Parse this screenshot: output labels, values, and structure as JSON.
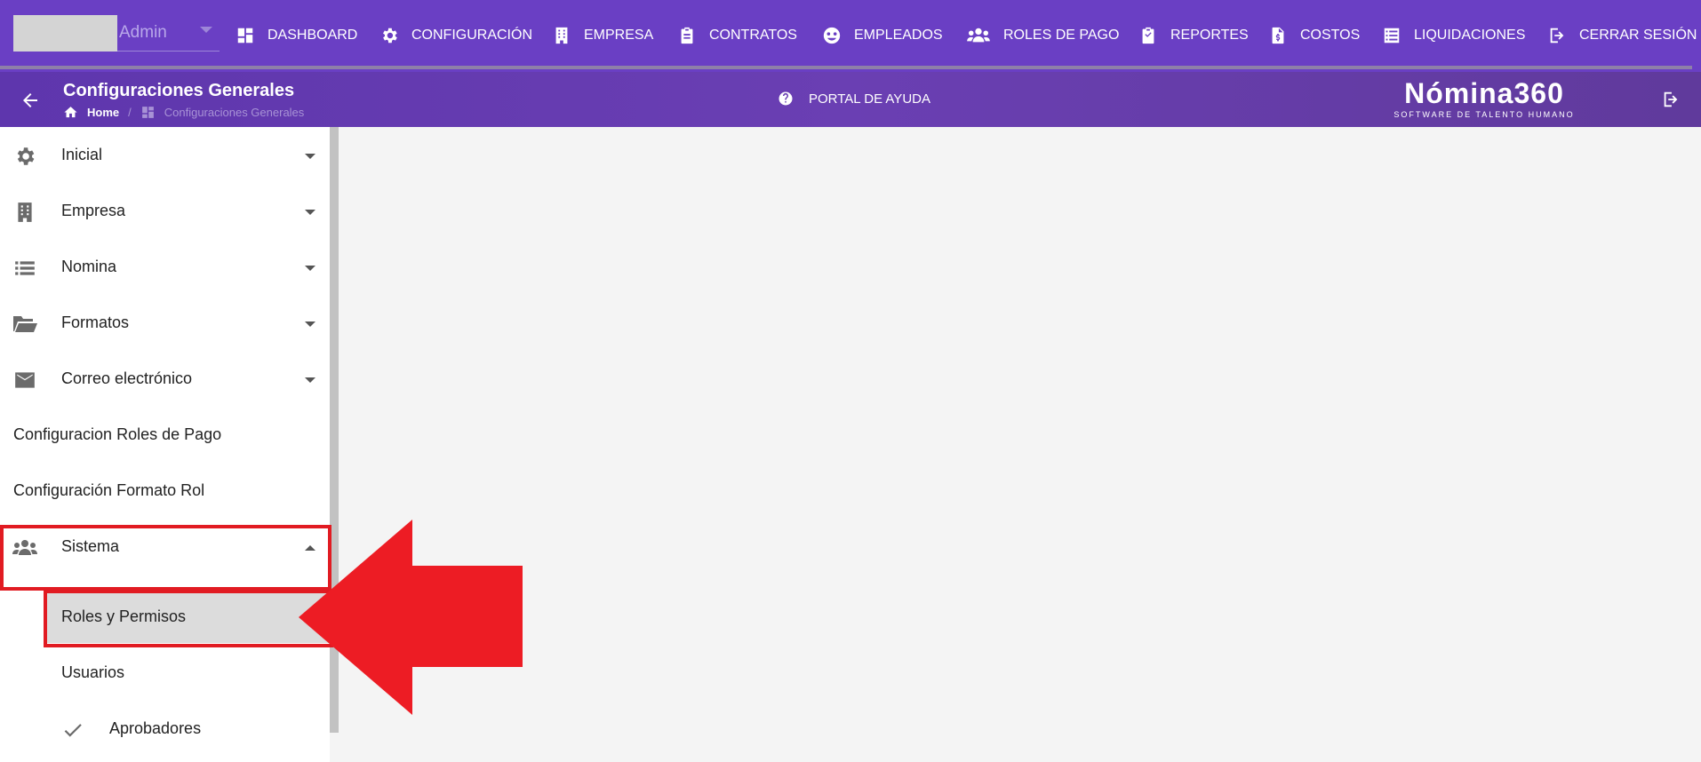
{
  "user": {
    "name": "Admin"
  },
  "nav": [
    {
      "label": "DASHBOARD",
      "icon": "dashboard-icon"
    },
    {
      "label": "CONFIGURACIÓN",
      "icon": "gear-icon"
    },
    {
      "label": "EMPRESA",
      "icon": "building-icon"
    },
    {
      "label": "CONTRATOS",
      "icon": "clipboard-icon"
    },
    {
      "label": "EMPLEADOS",
      "icon": "employees-icon"
    },
    {
      "label": "ROLES DE PAGO",
      "icon": "users-icon"
    },
    {
      "label": "REPORTES",
      "icon": "report-icon"
    },
    {
      "label": "COSTOS",
      "icon": "invoice-icon"
    },
    {
      "label": "LIQUIDACIONES",
      "icon": "list-icon"
    },
    {
      "label": "CERRAR SESIÓN",
      "icon": "logout-icon"
    }
  ],
  "header": {
    "title": "Configuraciones Generales",
    "breadcrumb": {
      "home": "Home",
      "separator": "/",
      "current": "Configuraciones Generales"
    },
    "help": "PORTAL DE AYUDA",
    "logo_main": "Nómina360",
    "logo_sub": "SOFTWARE DE TALENTO HUMANO"
  },
  "sidebar": {
    "items": [
      {
        "label": "Inicial",
        "icon": "gear-icon",
        "expandable": true,
        "expanded": false
      },
      {
        "label": "Empresa",
        "icon": "building-icon",
        "expandable": true,
        "expanded": false
      },
      {
        "label": "Nomina",
        "icon": "list-icon",
        "expandable": true,
        "expanded": false
      },
      {
        "label": "Formatos",
        "icon": "folder-open-icon",
        "expandable": true,
        "expanded": false
      },
      {
        "label": "Correo electrónico",
        "icon": "mail-icon",
        "expandable": true,
        "expanded": false
      },
      {
        "label": "Configuracion Roles de Pago"
      },
      {
        "label": "Configuración Formato Rol"
      },
      {
        "label": "Sistema",
        "icon": "users-icon",
        "expandable": true,
        "expanded": true
      },
      {
        "label": "Roles y Permisos",
        "active": true
      },
      {
        "label": "Usuarios"
      },
      {
        "label": "Aprobadores",
        "icon": "check-icon"
      }
    ]
  },
  "colors": {
    "nav_bg": "#6a3fc4",
    "highlight": "#e11b22",
    "arrow": "#ed1c24"
  }
}
